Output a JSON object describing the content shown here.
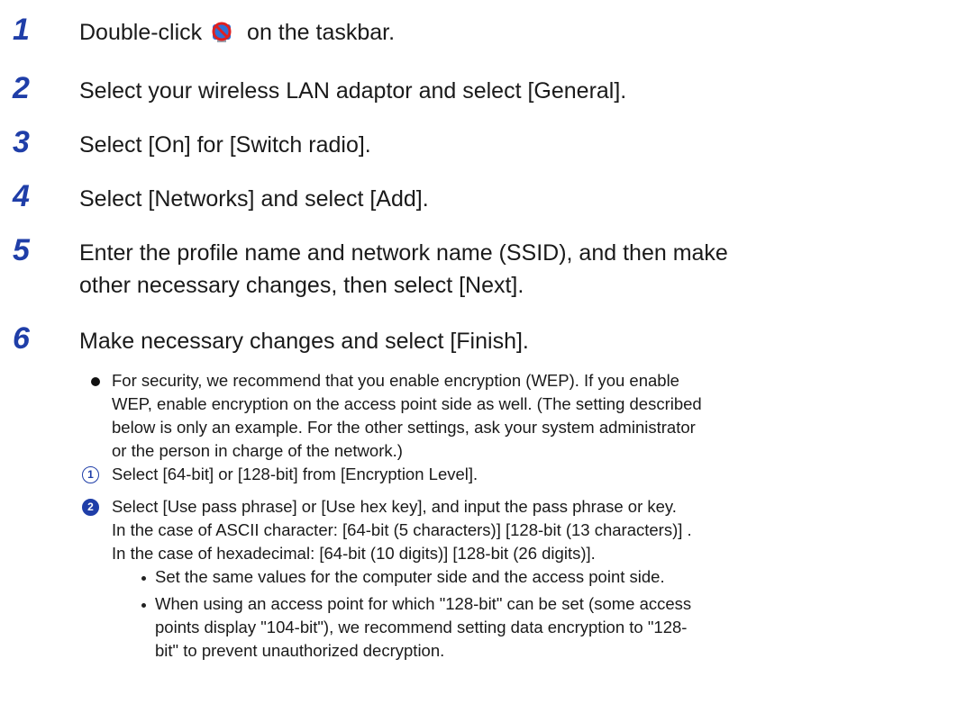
{
  "steps": [
    {
      "num": "1",
      "text_before": "Double-click ",
      "icon": "wireless-disabled-tray-icon",
      "text_after": " on the taskbar."
    },
    {
      "num": "2",
      "text": "Select your wireless LAN adaptor and select [General]."
    },
    {
      "num": "3",
      "text": "Select [On] for [Switch radio]."
    },
    {
      "num": "4",
      "text": "Select [Networks] and select [Add]."
    },
    {
      "num": "5",
      "line1": "Enter the profile name and network name (SSID), and then make",
      "line2": "other necessary changes, then select [Next]."
    },
    {
      "num": "6",
      "text": "Make necessary changes and select [Finish]."
    }
  ],
  "note": {
    "lines": [
      "For security, we recommend that you enable encryption (WEP). If you enable",
      "WEP, enable encryption on the access point side as well. (The setting described",
      "below is only an example. For the other settings, ask your system administrator",
      "or the person in charge of the network.)"
    ]
  },
  "substeps": [
    {
      "marker": "1",
      "lines": [
        "Select [64-bit] or [128-bit] from [Encryption Level]."
      ]
    },
    {
      "marker": "2",
      "lines": [
        "Select [Use pass phrase] or [Use hex key], and input the pass phrase or key.",
        "In the case of ASCII character: [64-bit (5 characters)] [128-bit (13 characters)] .",
        "In the case of hexadecimal: [64-bit (10 digits)] [128-bit (26 digits)]."
      ]
    }
  ],
  "subbullets": [
    {
      "lines": [
        "Set the same values for the computer side and the access point side."
      ]
    },
    {
      "lines": [
        "When using an access point for which \"128-bit\" can be set (some access",
        "points display \"104-bit\"), we recommend setting data encryption to \"128-",
        "bit\" to prevent unauthorized decryption."
      ]
    }
  ]
}
